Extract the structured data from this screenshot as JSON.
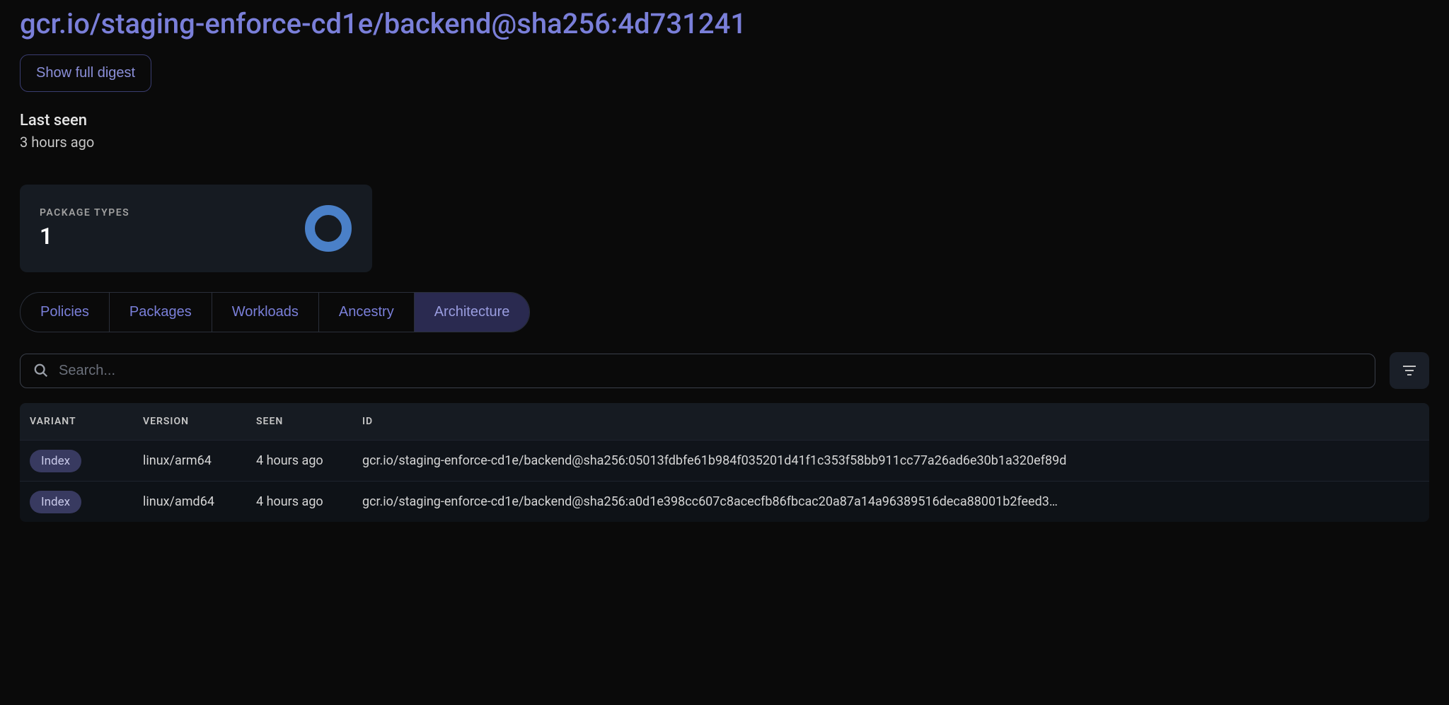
{
  "header": {
    "title": "gcr.io/staging-enforce-cd1e/backend@sha256:4d731241",
    "digest_button": "Show full digest"
  },
  "meta": {
    "last_seen_label": "Last seen",
    "last_seen_value": "3 hours ago"
  },
  "card": {
    "label": "PACKAGE TYPES",
    "value": "1",
    "donut_color": "#4a80c8"
  },
  "tabs": [
    {
      "label": "Policies",
      "active": false
    },
    {
      "label": "Packages",
      "active": false
    },
    {
      "label": "Workloads",
      "active": false
    },
    {
      "label": "Ancestry",
      "active": false
    },
    {
      "label": "Architecture",
      "active": true
    }
  ],
  "search": {
    "placeholder": "Search..."
  },
  "table": {
    "headers": {
      "variant": "VARIANT",
      "version": "VERSION",
      "seen": "SEEN",
      "id": "ID"
    },
    "rows": [
      {
        "variant": "Index",
        "version": "linux/arm64",
        "seen": "4 hours ago",
        "id": "gcr.io/staging-enforce-cd1e/backend@sha256:05013fdbfe61b984f035201d41f1c353f58bb911cc77a26ad6e30b1a320ef89d"
      },
      {
        "variant": "Index",
        "version": "linux/amd64",
        "seen": "4 hours ago",
        "id": "gcr.io/staging-enforce-cd1e/backend@sha256:a0d1e398cc607c8acecfb86fbcac20a87a14a96389516deca88001b2feed3…"
      }
    ]
  }
}
